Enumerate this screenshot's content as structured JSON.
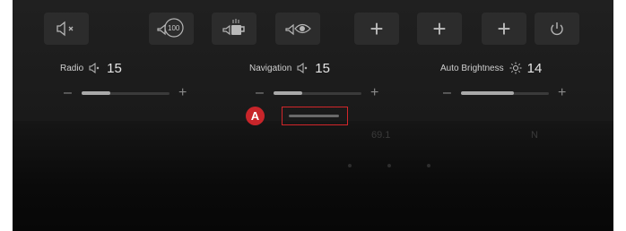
{
  "quick_buttons": [
    {
      "name": "mute-button",
      "icon": "speaker-mute-icon"
    },
    {
      "name": "volume-100-button",
      "icon": "volume-100-icon"
    },
    {
      "name": "coffee-button",
      "icon": "coffee-cup-icon"
    },
    {
      "name": "eye-speaker-button",
      "icon": "speaker-eye-icon"
    },
    {
      "name": "add-button-1",
      "icon": "plus-icon",
      "glyph": "+"
    },
    {
      "name": "add-button-2",
      "icon": "plus-icon",
      "glyph": "+"
    },
    {
      "name": "add-button-3",
      "icon": "plus-icon",
      "glyph": "+"
    },
    {
      "name": "power-button",
      "icon": "power-icon"
    }
  ],
  "sliders": {
    "radio": {
      "label": "Radio",
      "value": "15",
      "level": 0.33,
      "minus": "–",
      "plus": "+"
    },
    "navigation": {
      "label": "Navigation",
      "value": "15",
      "level": 0.33,
      "minus": "–",
      "plus": "+"
    },
    "brightness": {
      "label": "Auto Brightness",
      "value": "14",
      "level": 0.6,
      "minus": "–",
      "plus": "+"
    }
  },
  "annotation": {
    "marker": "A"
  },
  "background": {
    "faint_text": "69.1",
    "faint_text_right": "N"
  },
  "colors": {
    "panel": "#1e1e1e",
    "button": "#2c2c2c",
    "highlight": "#d2262a"
  }
}
